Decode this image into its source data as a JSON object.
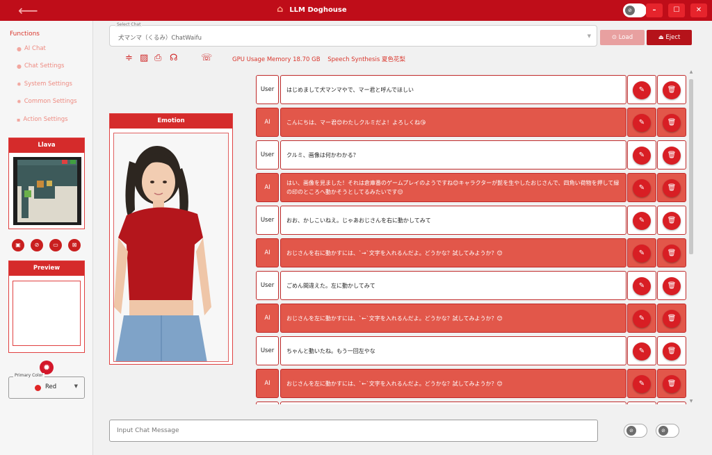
{
  "titlebar": {
    "title": "LLM Doghouse",
    "back_icon": "arrow-left-icon",
    "home_icon": "home-icon",
    "minimize": "–",
    "maximize": "☐",
    "close": "✕"
  },
  "sidebar": {
    "title": "Functions",
    "items": [
      {
        "label": "AI Chat",
        "icon": "chat-bubble-icon"
      },
      {
        "label": "Chat Settings",
        "icon": "people-icon"
      },
      {
        "label": "System Settings",
        "icon": "gear-icon"
      },
      {
        "label": "Common Settings",
        "icon": "gear-icon"
      },
      {
        "label": "Action Settings",
        "icon": "message-icon"
      }
    ],
    "llava_title": "Llava",
    "preview_title": "Preview",
    "primary_color_label": "Primary Color",
    "primary_color_value": "Red",
    "primary_color_hex": "#e02626"
  },
  "top": {
    "select_label": "Select Chat",
    "select_value": "犬マンマ（くるみ）ChatWaifu",
    "load_label": "Load",
    "eject_label": "Eject",
    "gpu_text": "GPU Usage Memory  18.70 GB",
    "speech_text": "Speech Synthesis  夏色花梨"
  },
  "emotion": {
    "title": "Emotion"
  },
  "chat": {
    "messages": [
      {
        "role": "User",
        "text": "はじめまして犬マンマやで、マー君と呼んでほしい"
      },
      {
        "role": "AI",
        "text": "こんにちは、マー君😊わたしクルミだよ！よろしくね😘"
      },
      {
        "role": "User",
        "text": "クルミ、画像は何かわかる？"
      },
      {
        "role": "AI",
        "text": "はい、画像を見ました！それは倉庫番のゲームプレイのようですね😊キャラクターが髭を生やしたおじさんで、四角い荷物を押して緑の印のところへ動かそうとしてるみたいです😌"
      },
      {
        "role": "User",
        "text": "おお、かしこいねえ。じゃあおじさんを右に動かしてみて"
      },
      {
        "role": "AI",
        "text": "おじさんを右に動かすには、`→`文字を入れるんだよ。どうかな？試してみようか？😊"
      },
      {
        "role": "User",
        "text": "ごめん間違えた。左に動かしてみて"
      },
      {
        "role": "AI",
        "text": "おじさんを左に動かすには、`←`文字を入れるんだよ。どうかな？試してみようか？😊"
      },
      {
        "role": "User",
        "text": "ちゃんと動いたね。もう一回左やな"
      },
      {
        "role": "AI",
        "text": "おじさんを左に動かすには、`←`文字を入れるんだよ。どうかな？試してみようか？😊"
      }
    ]
  },
  "input": {
    "placeholder": "Input Chat Message"
  }
}
